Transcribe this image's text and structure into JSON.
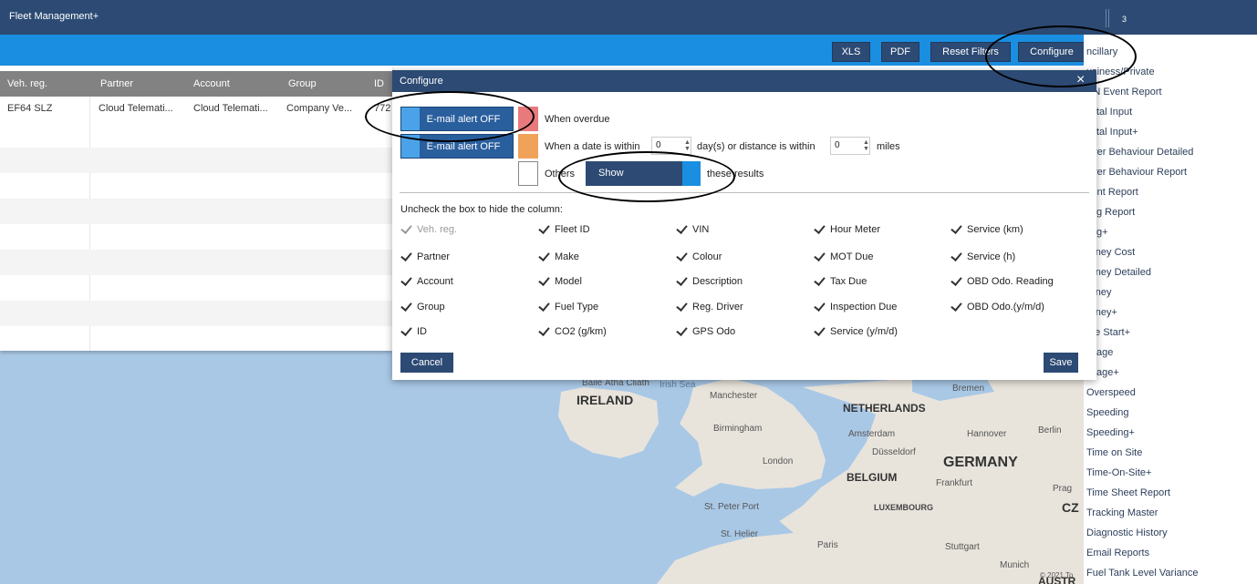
{
  "app": {
    "title": "Fleet Management+",
    "top_number": "3"
  },
  "toolbar": {
    "xls": "XLS",
    "pdf": "PDF",
    "reset_filters": "Reset Filters",
    "configure": "Configure"
  },
  "grid": {
    "columns": [
      "Veh. reg.",
      "Partner",
      "Account",
      "Group",
      "ID"
    ],
    "rows": [
      [
        "EF64 SLZ",
        "Cloud Telemati...",
        "Cloud Telemati...",
        "Company Ve...",
        "772"
      ]
    ]
  },
  "right_list": {
    "items": [
      "ncillary",
      "usiness/Private",
      "AN Event Report",
      "igital Input",
      "igital Input+",
      "river Behaviour Detailed",
      "river Behaviour Report",
      "vent Report",
      "ling Report",
      "ling+",
      "urney Cost",
      "urney Detailed",
      "urney",
      "urney+",
      "ate Start+",
      "ileage",
      "ileage+",
      "Overspeed",
      "Speeding",
      "Speeding+",
      "Time on Site",
      "Time-On-Site+",
      "Time Sheet Report",
      "Tracking Master",
      "Diagnostic History",
      "Email Reports",
      "Fuel Tank Level Variance"
    ]
  },
  "modal": {
    "title": "Configure",
    "close": "×",
    "alert1": "E-mail alert OFF",
    "alert2": "E-mail alert OFF",
    "when_overdue": "When overdue",
    "when_date_within": "When a date is within",
    "days_value": "0",
    "days_or_distance": "day(s) or distance is within",
    "miles_value": "0",
    "miles": "miles",
    "others": "Others",
    "show": "Show",
    "these_results": "these results",
    "uncheck_label": "Uncheck the box to hide the column:",
    "columns": [
      [
        "Veh. reg.",
        "Partner",
        "Account",
        "Group",
        "ID"
      ],
      [
        "Fleet ID",
        "Make",
        "Model",
        "Fuel Type",
        "CO2 (g/km)"
      ],
      [
        "VIN",
        "Colour",
        "Description",
        "Reg. Driver",
        "GPS Odo"
      ],
      [
        "Hour Meter",
        "MOT Due",
        "Tax Due",
        "Inspection Due",
        "Service (y/m/d)"
      ],
      [
        "Service (km)",
        "Service (h)",
        "OBD Odo. Reading",
        "OBD Odo.(y/m/d)"
      ]
    ],
    "cancel": "Cancel",
    "save": "Save"
  },
  "map": {
    "labels": {
      "baile": "Baile Átha Cliath",
      "irish_sea": "Irish Sea",
      "ireland": "IRELAND",
      "manchester": "Manchester",
      "birmingham": "Birmingham",
      "london": "London",
      "netherlands": "NETHERLANDS",
      "amsterdam": "Amsterdam",
      "bremen": "Bremen",
      "hannover": "Hannover",
      "berlin": "Berlin",
      "dusseldorf": "Düsseldorf",
      "germany": "GERMANY",
      "belgium": "BELGIUM",
      "frankfurt": "Frankfurt",
      "prag": "Prag",
      "luxembourg": "LUXEMBOURG",
      "cz": "CZ",
      "st_peter_port": "St. Peter Port",
      "st_helier": "St. Helier",
      "paris": "Paris",
      "stuttgart": "Stuttgart",
      "munich": "Munich",
      "copyright": "© 2021 To",
      "austria": "AUSTR"
    }
  },
  "colors": {
    "navy": "#2c4a73",
    "blue_bar": "#1a8ee0",
    "overdue_swatch": "#e87a7d",
    "within_swatch": "#f0a25a",
    "sea": "#a9c8e6",
    "land": "#e8e4dc"
  }
}
